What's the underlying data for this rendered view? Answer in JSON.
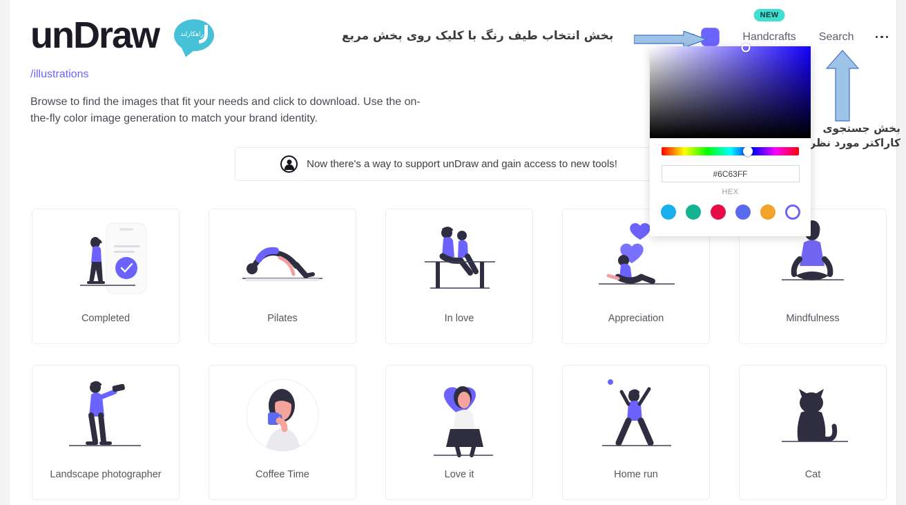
{
  "header": {
    "logo_text": "unDraw",
    "bubble_text": "راهکارلند",
    "breadcrumb": "/illustrations",
    "intro_text": "Browse to find the images that fit your needs and click to download. Use the on-the-fly color image generation to match your brand identity."
  },
  "nav": {
    "new_badge": "NEW",
    "handcrafts_label": "Handcrafts",
    "search_label": "Search",
    "swatch_color": "#6C63FF",
    "more_label": "..."
  },
  "color_picker": {
    "hex_value": "#6C63FF",
    "hex_label": "HEX",
    "hue_position_pct": 63,
    "presets": [
      {
        "name": "cyan",
        "color": "#17B0EC"
      },
      {
        "name": "teal",
        "color": "#14B391"
      },
      {
        "name": "crimson",
        "color": "#E70B48"
      },
      {
        "name": "periwinkle",
        "color": "#5A6BEF"
      },
      {
        "name": "orange",
        "color": "#F3A22B"
      },
      {
        "name": "custom-ring",
        "color": "#6C63FF"
      }
    ]
  },
  "annotations": {
    "top_note": "بخش انتخاب طیف رنگ با کلیک روی بخش مربع",
    "right_note_line1": "بخش جستجوی",
    "right_note_line2": "کاراکتر مورد نظر",
    "arrow_color": "#9DC3E6",
    "arrow_border": "#4472C4"
  },
  "banner": {
    "text": "Now there's a way to support unDraw and gain access to new tools!"
  },
  "cards": [
    {
      "label": "Completed",
      "art": "completed"
    },
    {
      "label": "Pilates",
      "art": "pilates"
    },
    {
      "label": "In love",
      "art": "in-love"
    },
    {
      "label": "Appreciation",
      "art": "appreciation"
    },
    {
      "label": "Mindfulness",
      "art": "mindfulness"
    },
    {
      "label": "Landscape photographer",
      "art": "photographer"
    },
    {
      "label": "Coffee Time",
      "art": "coffee"
    },
    {
      "label": "Love it",
      "art": "love-it"
    },
    {
      "label": "Home run",
      "art": "home-run"
    },
    {
      "label": "Cat",
      "art": "cat"
    }
  ],
  "theme": {
    "accent": "#6C63FF",
    "bubble": "#47C1D8",
    "badge": "#3FE0D0"
  }
}
